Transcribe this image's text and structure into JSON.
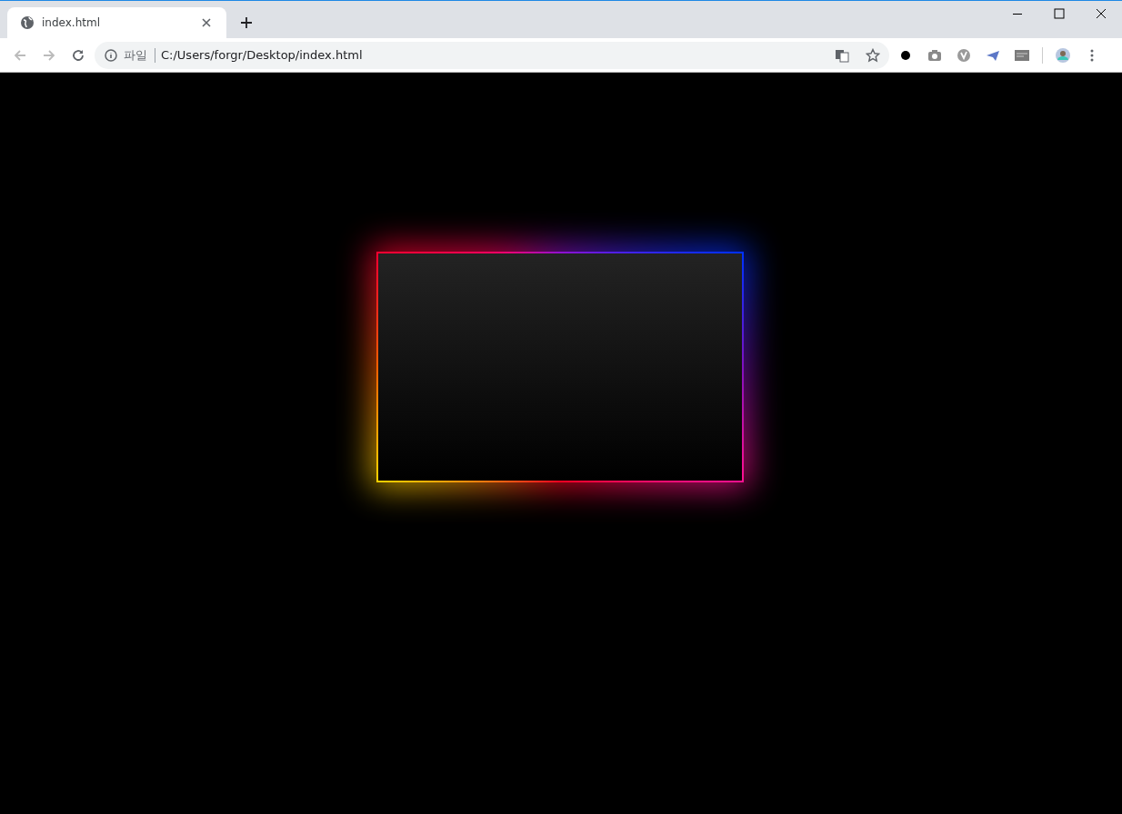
{
  "tabs": [
    {
      "title": "index.html",
      "selected": true
    }
  ],
  "address_bar": {
    "scheme_label": "파일",
    "url": "C:/Users/forgr/Desktop/index.html"
  }
}
